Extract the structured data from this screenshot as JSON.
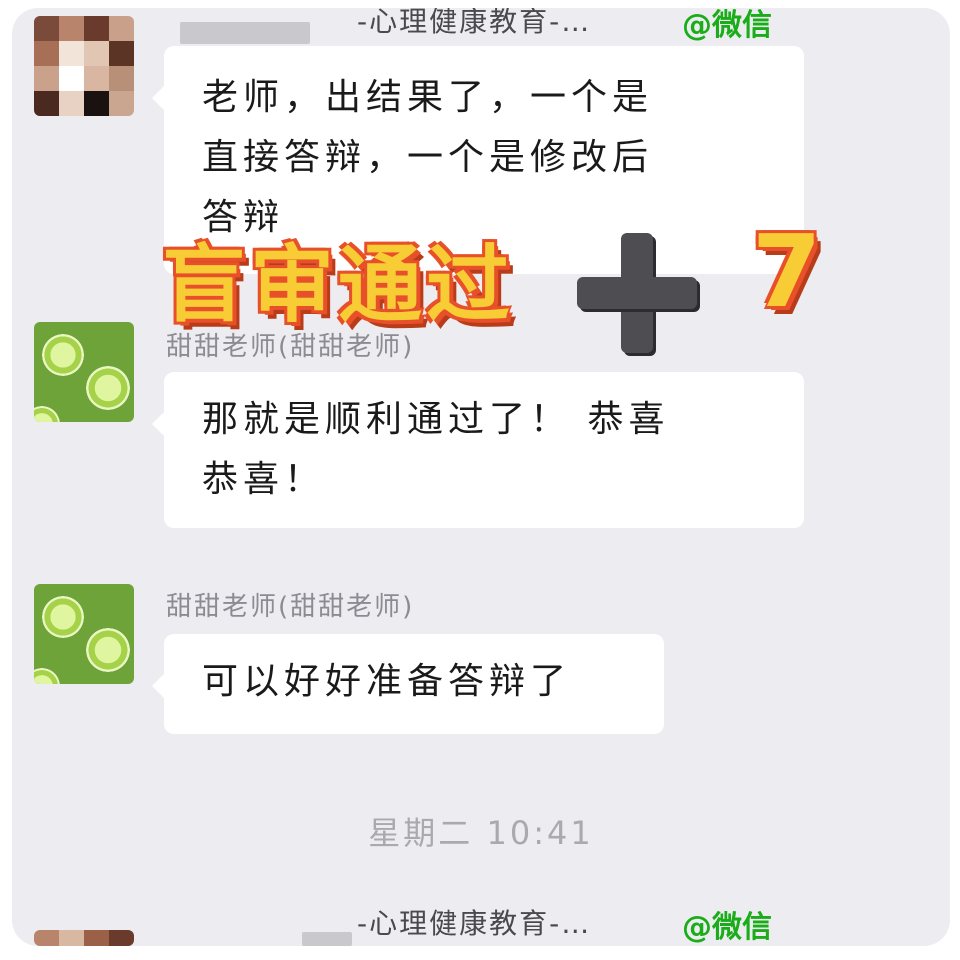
{
  "watermark": {
    "top_text": "-心理健康教育-…",
    "top_source": "@微信",
    "bottom_text": "-心理健康教育-…",
    "bottom_source": "@微信"
  },
  "overlay": {
    "headline": "盲审通过",
    "plus_symbol": "plus-icon",
    "count": "7",
    "colors": {
      "fill": "#f8cc35",
      "outline": "#e8502a",
      "plus": "#4d4d52"
    }
  },
  "messages": [
    {
      "sender": "",
      "avatar": "pixelated-avatar",
      "lines": [
        "老师，出结果了，一个是",
        "直接答辩，一个是修改后",
        "答辩"
      ]
    },
    {
      "sender": "甜甜老师(甜甜老师)",
      "avatar": "lime-avatar",
      "lines": [
        "那就是顺利通过了！ 恭喜",
        "恭喜！"
      ]
    },
    {
      "sender": "甜甜老师(甜甜老师)",
      "avatar": "lime-avatar",
      "lines": [
        "可以好好准备答辩了"
      ]
    }
  ],
  "timestamp": "星期二 10:41",
  "colors": {
    "background": "#ededf1",
    "bubble": "#ffffff",
    "wechat_green": "#1aad19"
  }
}
